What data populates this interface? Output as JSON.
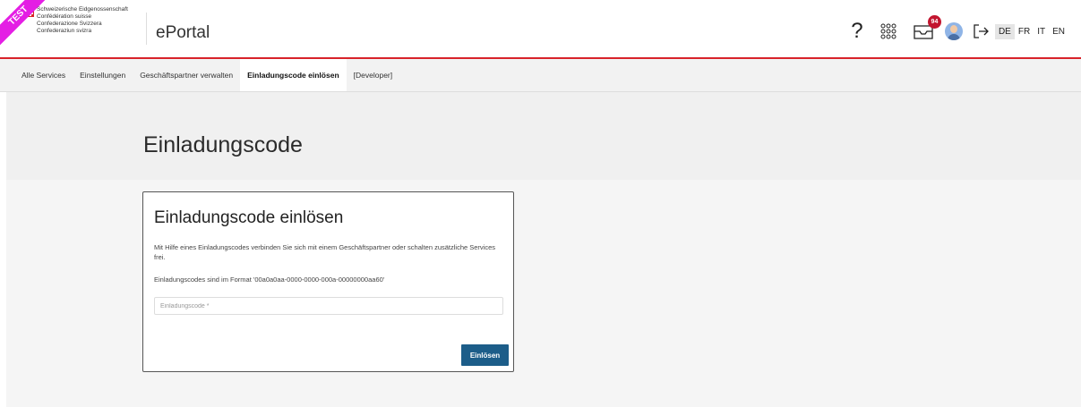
{
  "header": {
    "test_label": "TEST",
    "confederation_lines": [
      "Schweizerische Eidgenossenschaft",
      "Confédération suisse",
      "Confederazione Svizzera",
      "Confederaziun svizra"
    ],
    "app_name": "ePortal",
    "help_label": "?",
    "notification_count": "94",
    "languages": [
      "DE",
      "FR",
      "IT",
      "EN"
    ],
    "active_language": "DE",
    "icons": [
      "help-icon",
      "apps-grid-icon",
      "inbox-icon",
      "avatar",
      "logout-icon"
    ]
  },
  "nav": {
    "items": [
      "Alle Services",
      "Einstellungen",
      "Geschäftspartner verwalten",
      "Einladungscode einlösen",
      "[Developer]"
    ],
    "active": "Einladungscode einlösen"
  },
  "page": {
    "title": "Einladungscode"
  },
  "card": {
    "title": "Einladungscode einlösen",
    "description": "Mit Hilfe eines Einladungscodes verbinden Sie sich mit einem Geschäftspartner oder schalten zusätzliche Services frei.",
    "format_text": "Einladungscodes sind im Format '00a0a0aa-0000-0000-000a-00000000aa60'",
    "input_placeholder": "Einladungscode *",
    "input_value": "",
    "submit_label": "Einlösen"
  },
  "colors": {
    "accent_red": "#d8232a",
    "test_ribbon": "#e41ee4",
    "button_blue": "#1c5d89",
    "badge_red": "#c2152f"
  }
}
